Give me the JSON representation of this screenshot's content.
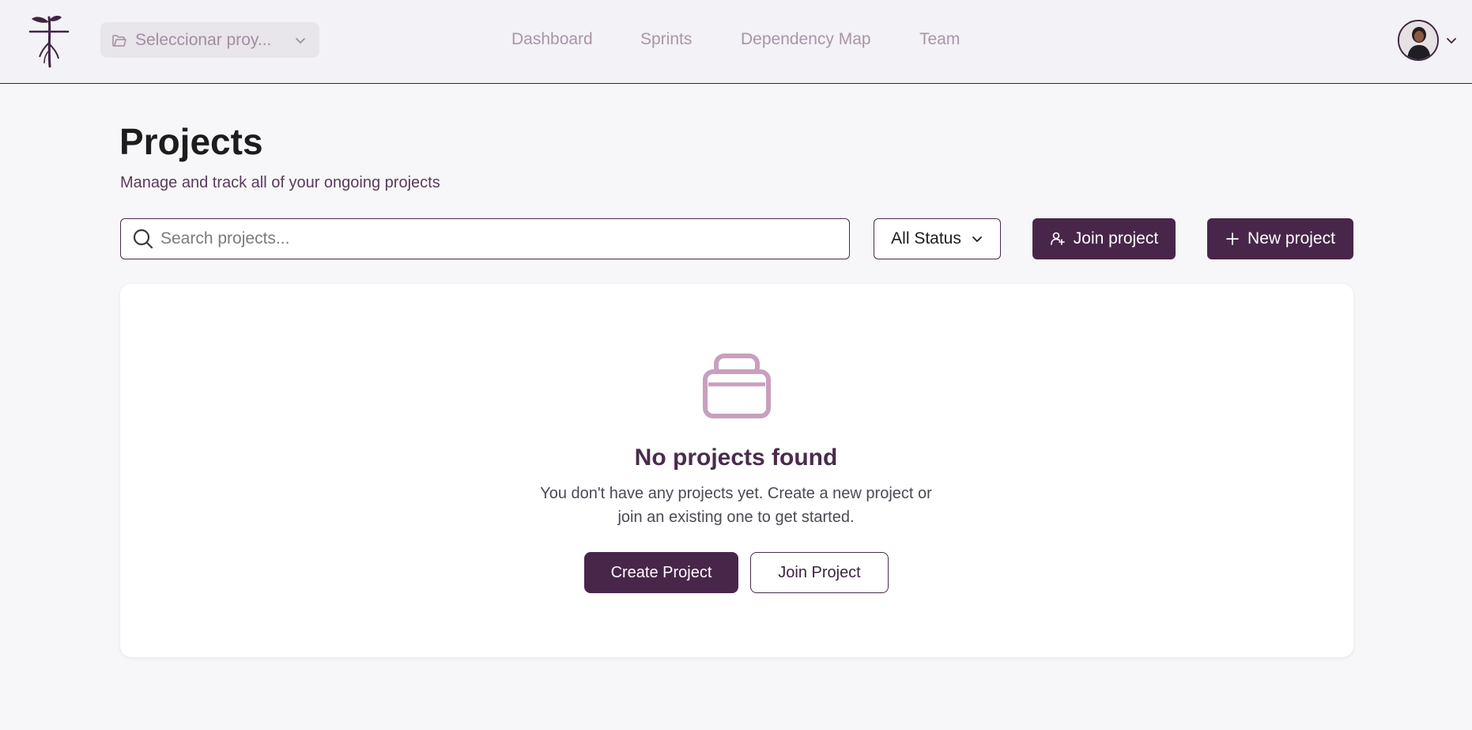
{
  "header": {
    "project_selector": {
      "label": "Seleccionar proy..."
    },
    "nav": [
      {
        "label": "Dashboard"
      },
      {
        "label": "Sprints"
      },
      {
        "label": "Dependency Map"
      },
      {
        "label": "Team"
      }
    ]
  },
  "main": {
    "title": "Projects",
    "subtitle": "Manage and track all of your ongoing projects",
    "search": {
      "placeholder": "Search projects...",
      "value": ""
    },
    "status_filter": {
      "selected": "All Status"
    },
    "join_button": "Join project",
    "new_button": "New project"
  },
  "empty_state": {
    "title": "No projects found",
    "line1": "You don't have any projects yet. Create a new project or",
    "line2": "join an existing one to get started.",
    "create_button": "Create Project",
    "join_button": "Join Project"
  },
  "colors": {
    "brand": "#48264a",
    "nav_text": "#a995a9",
    "empty_icon": "#c8a0bd"
  },
  "icons": [
    "logo-icon",
    "folder-icon",
    "chevron-down-icon",
    "search-icon",
    "user-plus-icon",
    "plus-icon",
    "archive-icon",
    "avatar"
  ]
}
